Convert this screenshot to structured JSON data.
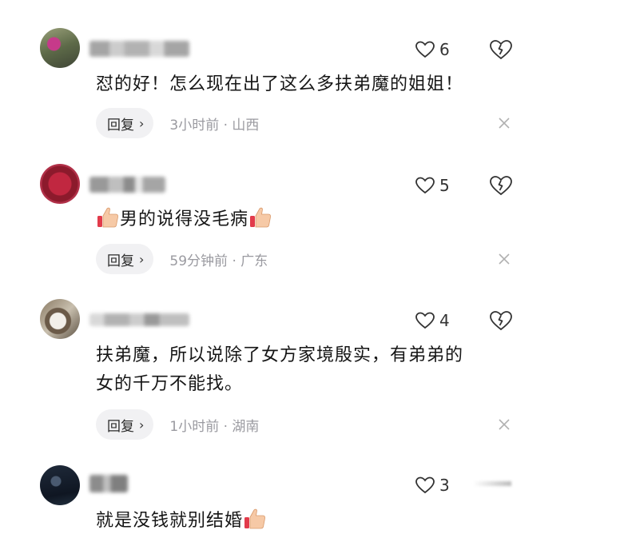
{
  "comments": [
    {
      "likes": "6",
      "text_lines": [
        "怼的好！怎么现在出了这么多扶弟魔的姐姐！"
      ],
      "reply_label": "回复",
      "meta": "3小时前 · 山西"
    },
    {
      "likes": "5",
      "text_lines": [
        "男的说得没毛病"
      ],
      "reply_label": "回复",
      "meta": "59分钟前 · 广东"
    },
    {
      "likes": "4",
      "text_lines": [
        "扶弟魔，所以说除了女方家境殷实，有弟弟的",
        "女的千万不能找。"
      ],
      "reply_label": "回复",
      "meta": "1小时前 · 湖南"
    },
    {
      "likes": "3",
      "text_lines": [
        "就是没钱就别结婚"
      ]
    }
  ],
  "icons": {
    "like": "heart-outline-icon",
    "dislike": "broken-heart-icon",
    "close": "close-icon",
    "thumb": "thumbs-up-emoji-icon"
  }
}
